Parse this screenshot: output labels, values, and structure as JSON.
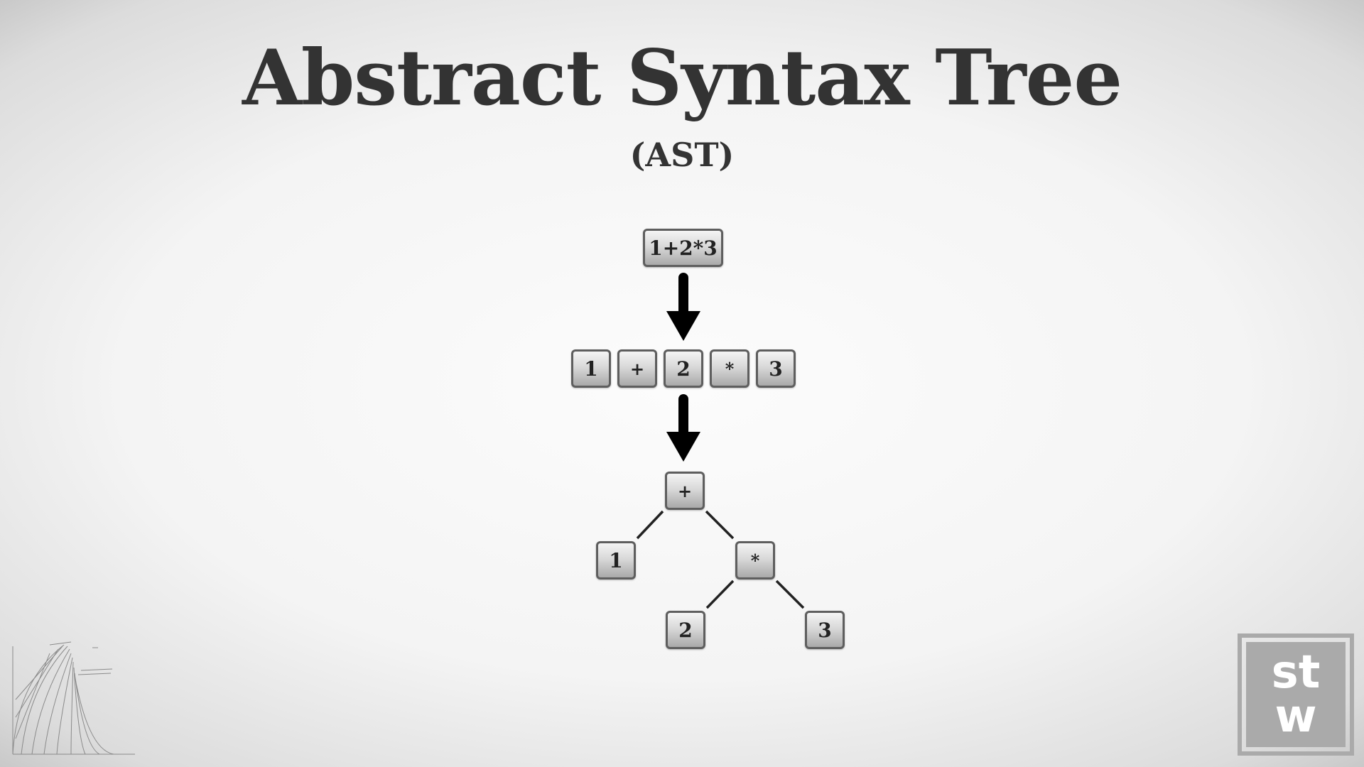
{
  "title": "Abstract Syntax Tree",
  "subtitle": "(AST)",
  "expression": "1+2*3",
  "tokens": [
    "1",
    "+",
    "2",
    "*",
    "3"
  ],
  "tree": {
    "root": "+",
    "left": "1",
    "right": "*",
    "right_left": "2",
    "right_right": "3"
  },
  "logo": {
    "line1": "st",
    "line2": "w"
  },
  "colors": {
    "text": "#333333",
    "node_border": "#5e5e5e",
    "arrow": "#000000",
    "logo": "#aaaaaa"
  }
}
